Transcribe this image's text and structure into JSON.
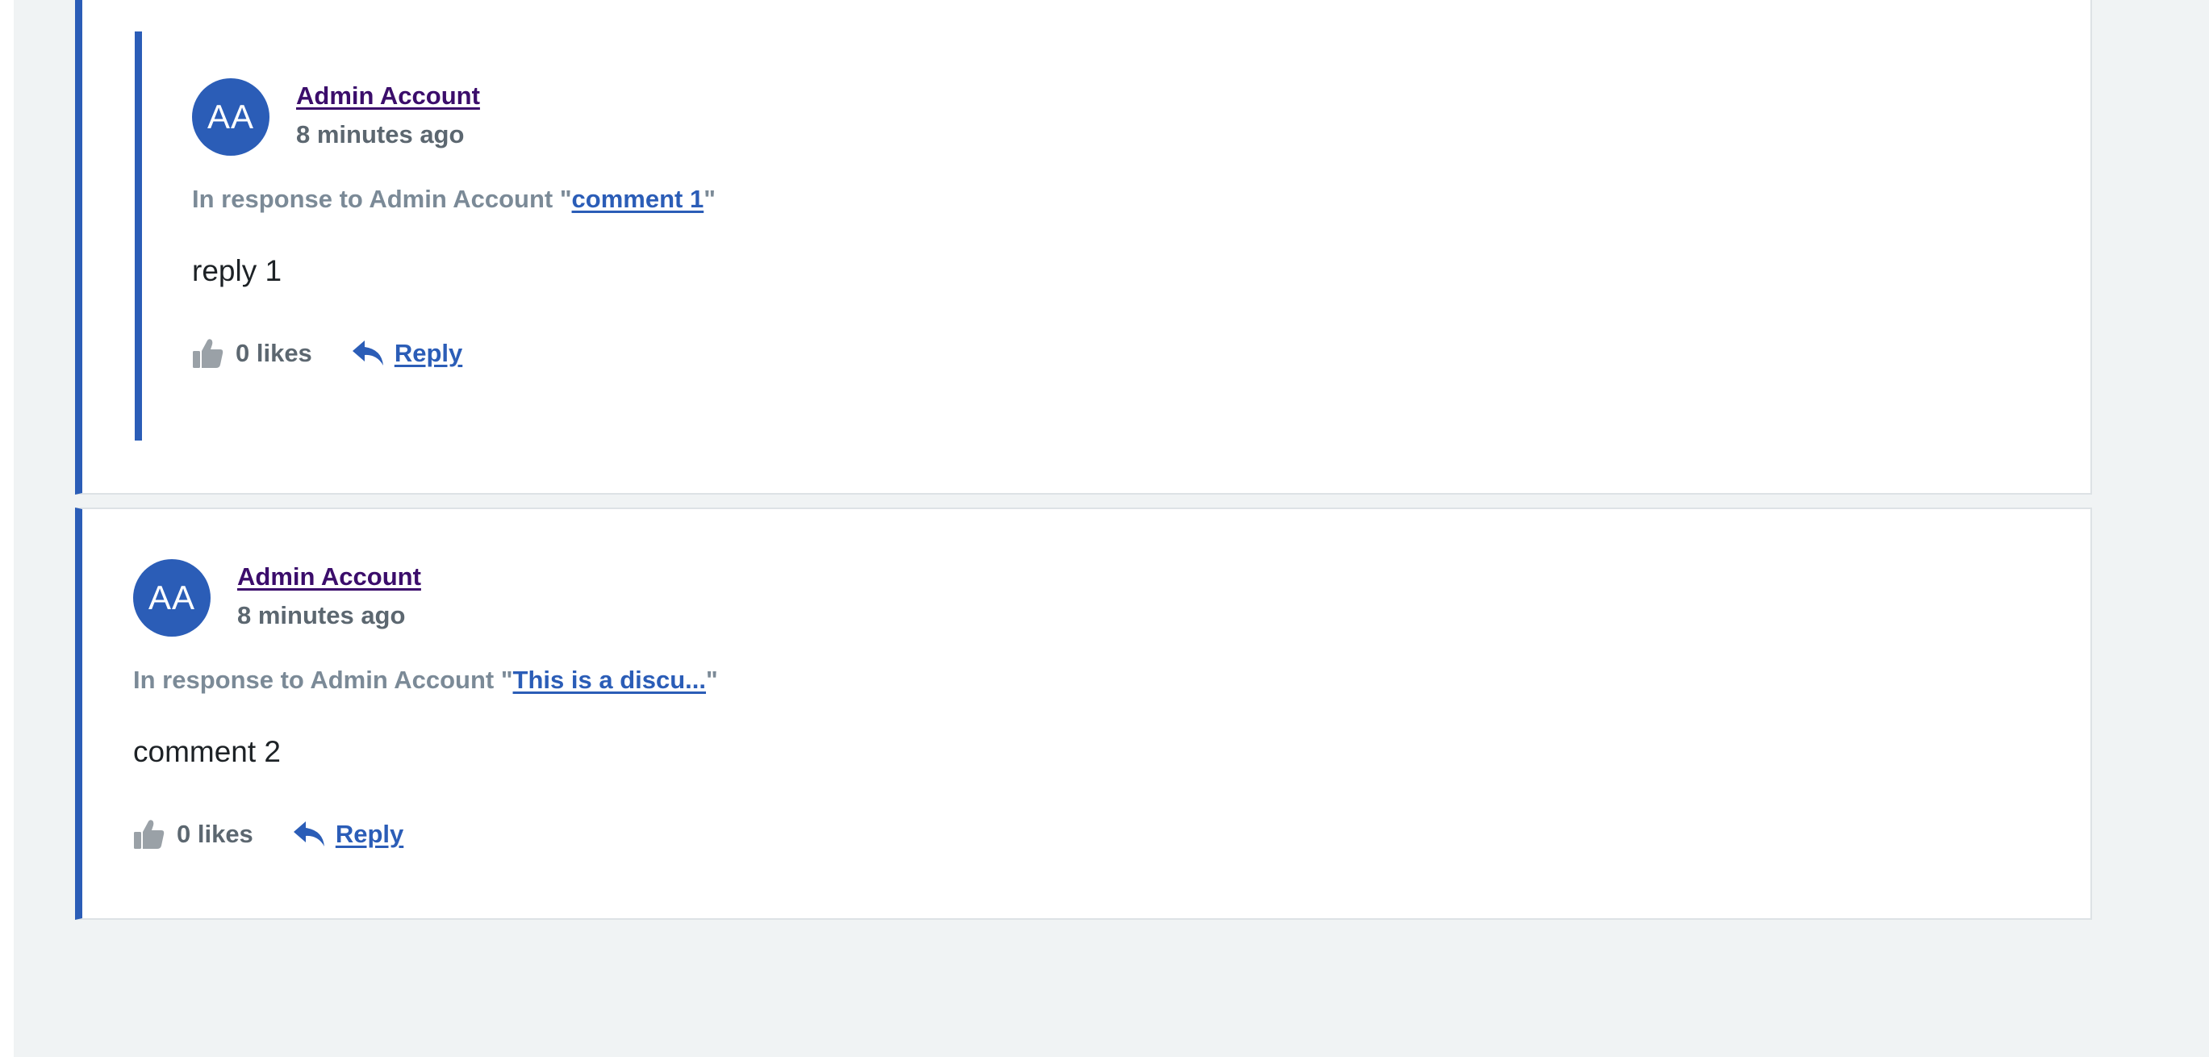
{
  "comments": [
    {
      "avatar_initials": "AA",
      "author": "Admin Account",
      "time": "8 minutes ago",
      "context_prefix": "In response to Admin Account \"",
      "context_link": "comment 1",
      "context_suffix": "\"",
      "body": "reply 1",
      "likes": "0 likes",
      "reply_label": "Reply",
      "icons": {
        "like": "thumbs-up-icon",
        "reply": "reply-arrow-icon"
      }
    },
    {
      "avatar_initials": "AA",
      "author": "Admin Account",
      "time": "8 minutes ago",
      "context_prefix": "In response to Admin Account \"",
      "context_link": "This is a discu...",
      "context_suffix": "\"",
      "body": "comment 2",
      "likes": "0 likes",
      "reply_label": "Reply",
      "icons": {
        "like": "thumbs-up-icon",
        "reply": "reply-arrow-icon"
      }
    }
  ],
  "colors": {
    "accent": "#2b5db7",
    "author_link": "#3b0d6b",
    "muted_text": "#5c6770",
    "context_text": "#7b8a97",
    "like_icon": "#9aa1a7",
    "page_background": "#f0f3f4",
    "card_background": "#ffffff"
  }
}
